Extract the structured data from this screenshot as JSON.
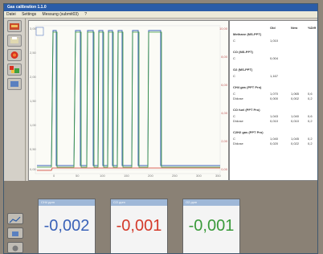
{
  "window": {
    "title": "Gas calibration 1.1.0"
  },
  "menu": [
    "Datei",
    "Settings",
    "Messung (submit03)",
    "?"
  ],
  "toolbar": {
    "icons": [
      "calibrate-icon",
      "print-icon",
      "globe-icon",
      "gas-icon",
      "display-icon"
    ]
  },
  "plot": {
    "left_ticks": [
      "3,00",
      "2,50",
      "2,00",
      "1,50",
      "1,00",
      "0,50",
      "0,00"
    ],
    "right_ticks": [
      "10,00",
      "8,00",
      "6,00",
      "4,00",
      "2,00",
      "0,00"
    ],
    "x_ticks": [
      "0",
      "50",
      "100",
      "150",
      "200",
      "250",
      "300",
      "350"
    ]
  },
  "table": {
    "headers": {
      "old": "Old",
      "new": "New",
      "pct": "%Diff"
    },
    "rows": [
      {
        "name": "Methane (MS-PPT)",
        "bold": true
      },
      {
        "name": "C",
        "old": "1,010"
      },
      {
        "name": "CO (MS-PPT)",
        "bold": true
      },
      {
        "name": "C",
        "old": "0,004"
      },
      {
        "name": "O2 (MS-PPT)",
        "bold": true
      },
      {
        "name": "C",
        "old": "1,167"
      },
      {
        "name": "CH4 gas (PPT Pro)",
        "bold": true
      },
      {
        "name": "C",
        "old": "1,070",
        "new": "1,065",
        "pct": "0,6"
      },
      {
        "name": "D/dose",
        "old": "0,000",
        "new": "0,002",
        "pct": "0,2"
      },
      {
        "name": "CO fuel (PPT Pro)",
        "bold": true
      },
      {
        "name": "C",
        "old": "1,043",
        "new": "1,040",
        "pct": "0,6"
      },
      {
        "name": "D/dose",
        "old": "0,010",
        "new": "0,010",
        "pct": "0,2"
      },
      {
        "name": "C2H2 gas (PPT Pro)",
        "bold": true
      },
      {
        "name": "C",
        "old": "1,040",
        "new": "1,045",
        "pct": "0,2"
      },
      {
        "name": "D/dose",
        "old": "0,020",
        "new": "0,022",
        "pct": "0,2"
      }
    ]
  },
  "gauges": [
    {
      "label": "CH4 ppm",
      "value": "-0,002",
      "color": "#3a62b8"
    },
    {
      "label": "CO ppm",
      "value": "-0,001",
      "color": "#d43a2a"
    },
    {
      "label": "O2 ppm",
      "value": "-0,001",
      "color": "#3a9a3a"
    }
  ]
}
